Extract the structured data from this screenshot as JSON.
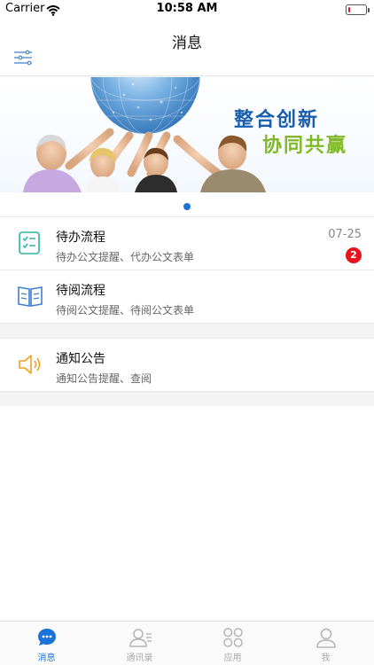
{
  "status_bar": {
    "carrier": "Carrier",
    "time": "10:58 AM",
    "battery_level": 0.12
  },
  "nav": {
    "title": "消息",
    "menu_icon": "filter-sliders-icon"
  },
  "banner": {
    "line1": "整合创新",
    "line2": "协同共赢",
    "line1_color": "#1a5fae",
    "line2_color": "#82b928",
    "page_count": 1,
    "active_page": 1
  },
  "messages": [
    {
      "title": "待办流程",
      "subtitle": "待办公文提醒、代办公文表单",
      "date": "07-25",
      "badge": "2",
      "icon": "checklist-icon"
    },
    {
      "title": "待阅流程",
      "subtitle": "待阅公文提醒、待阅公文表单",
      "icon": "open-book-icon"
    }
  ],
  "notices": [
    {
      "title": "通知公告",
      "subtitle": "通知公告提醒、查阅",
      "icon": "speaker-icon"
    }
  ],
  "tabs": [
    {
      "label": "消息",
      "icon": "chat-bubble-icon",
      "active": true
    },
    {
      "label": "通讯录",
      "icon": "contacts-icon",
      "active": false
    },
    {
      "label": "应用",
      "icon": "apps-grid-icon",
      "active": false
    },
    {
      "label": "我",
      "icon": "person-icon",
      "active": false
    }
  ],
  "colors": {
    "accent": "#1a73d8",
    "badge": "#e8141c",
    "checklist": "#2bb3a6",
    "book": "#3f7fd0",
    "speaker": "#f0a020"
  }
}
